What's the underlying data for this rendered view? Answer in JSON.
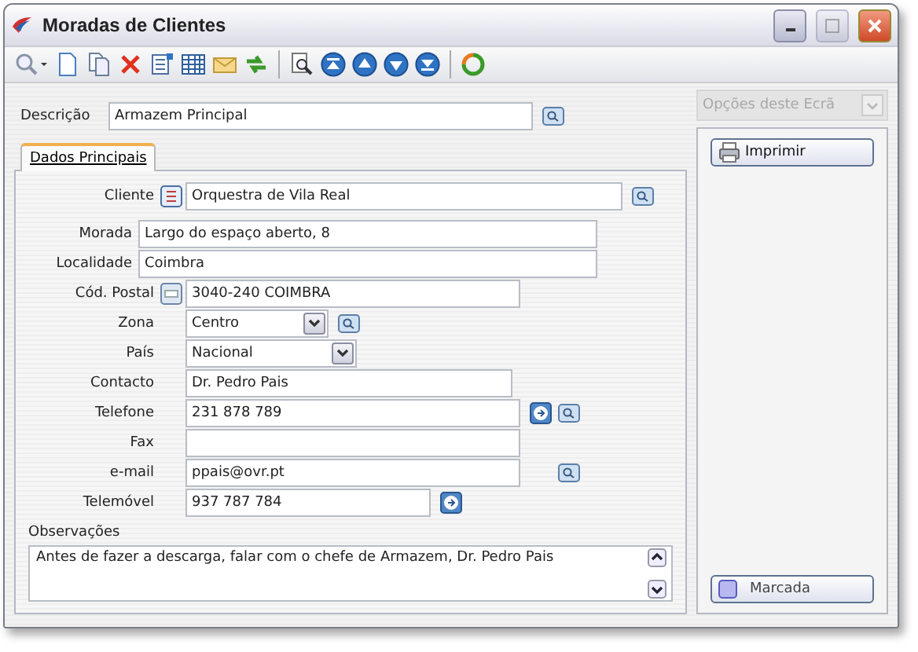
{
  "window": {
    "title": "Moradas de Clientes"
  },
  "descricao": {
    "label": "Descrição",
    "value": "Armazem Principal"
  },
  "tabs": [
    {
      "label": "Dados Principais",
      "selected": true
    }
  ],
  "fields": [
    {
      "label": "Cliente",
      "value": "Orquestra de Vila Real",
      "kind": "text"
    },
    {
      "label": "Morada",
      "value": "Largo do espaço aberto, 8",
      "kind": "text"
    },
    {
      "label": "Localidade",
      "value": "Coimbra",
      "kind": "text"
    },
    {
      "label": "Cód. Postal",
      "value": "3040-240 COIMBRA",
      "kind": "text"
    },
    {
      "label": "Zona",
      "value": "Centro",
      "kind": "select"
    },
    {
      "label": "País",
      "value": "Nacional",
      "kind": "select"
    },
    {
      "label": "Contacto",
      "value": "Dr. Pedro Pais",
      "kind": "text"
    },
    {
      "label": "Telefone",
      "value": "231 878 789",
      "kind": "text"
    },
    {
      "label": "Fax",
      "kind": "text"
    },
    {
      "label": "e-mail",
      "value": "ppais@ovr.pt",
      "kind": "text"
    },
    {
      "label": "Telemóvel",
      "value": "937 787 784",
      "kind": "text"
    }
  ],
  "observacoes": {
    "label": "Observações",
    "value": "Antes de fazer a descarga, falar com o chefe de Armazem, Dr. Pedro Pais"
  },
  "side_panel": {
    "dropdown": "Opções deste Ecrã",
    "dropdown_disabled": true,
    "buttons": [
      {
        "label": "Imprimir",
        "kind": "print"
      },
      {
        "label": "Marcada",
        "kind": "mark"
      }
    ]
  }
}
